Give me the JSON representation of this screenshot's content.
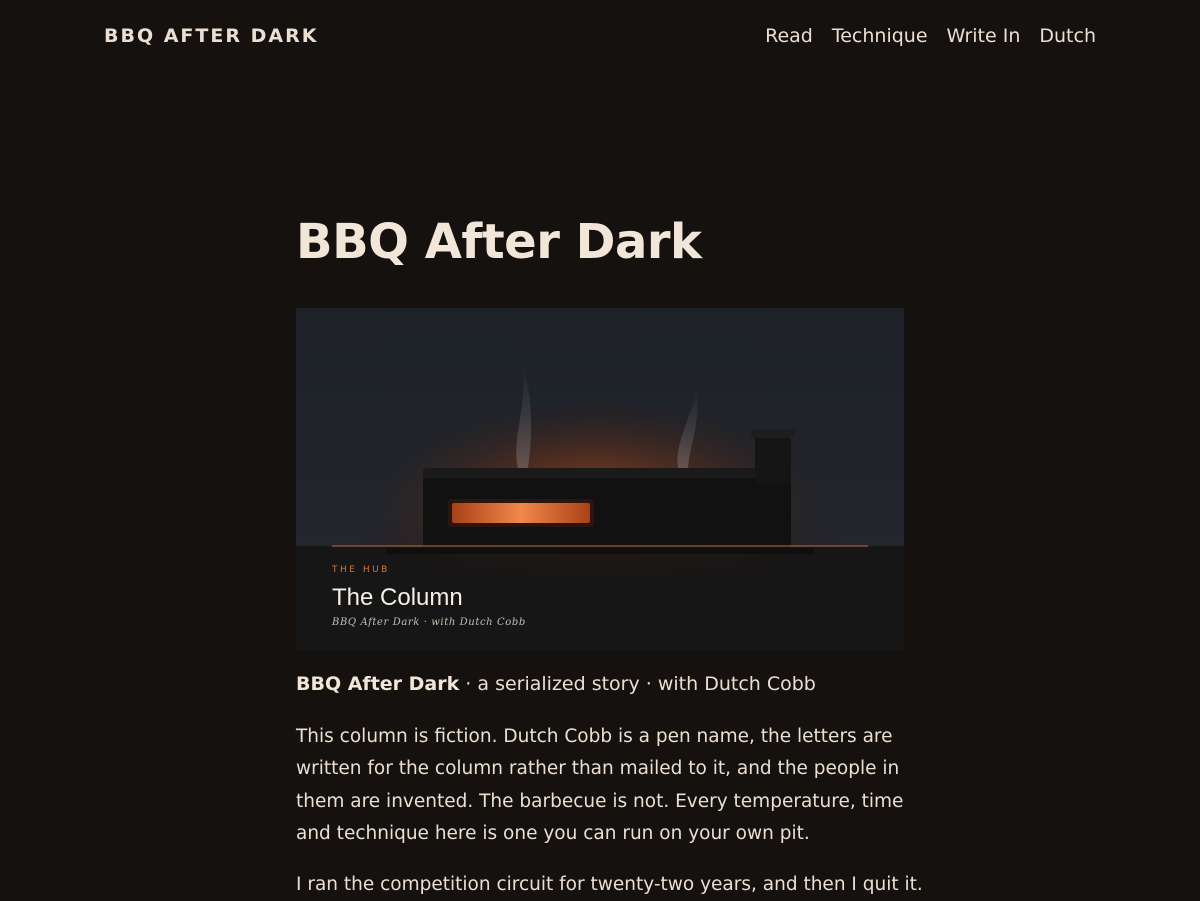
{
  "header": {
    "logo": "BBQ AFTER DARK",
    "nav": [
      {
        "label": "Read"
      },
      {
        "label": "Technique"
      },
      {
        "label": "Write In"
      },
      {
        "label": "Dutch"
      }
    ]
  },
  "main": {
    "title": "BBQ After Dark",
    "hero": {
      "kicker": "THE HUB",
      "title": "The Column",
      "byline": "BBQ After Dark · with Dutch Cobb",
      "colors": {
        "sky": "#1b1e23",
        "glow": "#a84a1c",
        "firebox": "#e0733a",
        "rule": "#c5663a"
      }
    },
    "meta": {
      "bold": "BBQ After Dark",
      "rest": " · a serialized story · with Dutch Cobb"
    },
    "paragraphs": [
      {
        "lines": [
          "This column is fiction. Dutch Cobb is a pen name, the letters are",
          "written for the column rather than mailed to it, and the people in",
          "them are invented. The barbecue is not. Every temperature, time",
          "and technique here is one you can run on your own pit."
        ]
      },
      {
        "lines": [
          "I ran the competition circuit for twenty-two years, and then I quit it."
        ]
      }
    ]
  }
}
